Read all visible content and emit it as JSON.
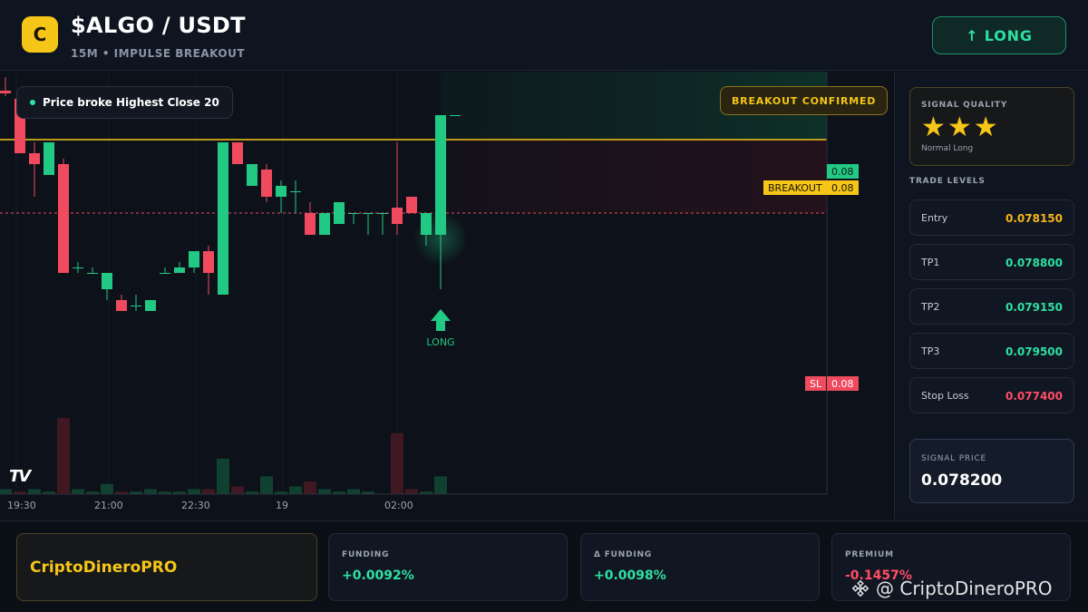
{
  "header": {
    "logo_letter": "C",
    "pair": "$ALGO / USDT",
    "subtitle": "15M • IMPULSE BREAKOUT",
    "direction_label": "↑ LONG"
  },
  "chart": {
    "tooltip": "Price broke Highest Close 20",
    "confirm_badge": "BREAKOUT CONFIRMED",
    "breakout_label": "BREAKOUT",
    "breakout_value": "0.08",
    "entry_value": "0.08",
    "sl_label": "SL",
    "sl_value": "0.08",
    "signal_marker": "LONG",
    "tv_logo": "TV",
    "time_labels": [
      "19:30",
      "21:00",
      "22:30",
      "19",
      "02:00"
    ]
  },
  "chart_data": {
    "type": "candlestick",
    "note_candles": "[open, high, low, close] approximate price units",
    "candles": [
      [
        0.07965,
        0.0799,
        0.07955,
        0.0796
      ],
      [
        0.0795,
        0.07955,
        0.0785,
        0.0785
      ],
      [
        0.0785,
        0.0787,
        0.0777,
        0.0783
      ],
      [
        0.0781,
        0.0782,
        0.0787,
        0.0787
      ],
      [
        0.0783,
        0.0784,
        0.0763,
        0.0763
      ],
      [
        0.0764,
        0.0765,
        0.0763,
        0.0764
      ],
      [
        0.0763,
        0.0764,
        0.0763,
        0.0763
      ],
      [
        0.076,
        0.0763,
        0.0758,
        0.0763
      ],
      [
        0.0758,
        0.0759,
        0.0756,
        0.0756
      ],
      [
        0.0757,
        0.0759,
        0.0756,
        0.0757
      ],
      [
        0.0756,
        0.0758,
        0.0756,
        0.0758
      ],
      [
        0.0763,
        0.0764,
        0.0763,
        0.0763
      ],
      [
        0.0763,
        0.0765,
        0.0763,
        0.0764
      ],
      [
        0.0764,
        0.0767,
        0.0763,
        0.0767
      ],
      [
        0.0767,
        0.0768,
        0.0759,
        0.0763
      ],
      [
        0.0759,
        0.0787,
        0.0759,
        0.0787
      ],
      [
        0.0787,
        0.0787,
        0.0783,
        0.0783
      ],
      [
        0.0779,
        0.0783,
        0.0779,
        0.0783
      ],
      [
        0.0782,
        0.0783,
        0.0776,
        0.0777
      ],
      [
        0.0777,
        0.078,
        0.0774,
        0.0779
      ],
      [
        0.0778,
        0.078,
        0.0774,
        0.0778
      ],
      [
        0.0774,
        0.0776,
        0.077,
        0.077
      ],
      [
        0.077,
        0.0774,
        0.077,
        0.0774
      ],
      [
        0.0772,
        0.0776,
        0.0772,
        0.0776
      ],
      [
        0.0774,
        0.0774,
        0.0772,
        0.0774
      ],
      [
        0.0774,
        0.0774,
        0.077,
        0.0774
      ],
      [
        0.0774,
        0.0774,
        0.077,
        0.0774
      ],
      [
        0.0775,
        0.0787,
        0.077,
        0.0772
      ],
      [
        0.0777,
        0.0777,
        0.0774,
        0.0774
      ],
      [
        0.077,
        0.0772,
        0.0768,
        0.0774
      ],
      [
        0.077,
        0.0792,
        0.076,
        0.0792
      ],
      [
        0.0792,
        0.0792,
        0.0792,
        0.0792
      ]
    ],
    "volumes": [
      2,
      1,
      2,
      1,
      30,
      2,
      1,
      4,
      1,
      1,
      2,
      1,
      1,
      2,
      2,
      14,
      3,
      1,
      7,
      1,
      3,
      5,
      2,
      1,
      2,
      1,
      0,
      24,
      2,
      1,
      7,
      0
    ],
    "volume_up": [
      true,
      false,
      true,
      true,
      false,
      true,
      true,
      true,
      false,
      true,
      true,
      true,
      true,
      true,
      false,
      true,
      false,
      true,
      true,
      true,
      true,
      false,
      true,
      true,
      true,
      true,
      true,
      false,
      false,
      true,
      true,
      true
    ],
    "levels": {
      "breakout": 0.07875,
      "stop_loss": 0.0774,
      "entry_box_top": 0.0796,
      "price_min": 0.074,
      "price_max": 0.08
    },
    "colors": {
      "up": "#22c985",
      "down": "#f04a5e",
      "breakout": "#f5c518",
      "sl": "#f04a5e"
    }
  },
  "sidebar": {
    "quality_label": "SIGNAL QUALITY",
    "stars": "★★★",
    "quality_note": "Normal Long",
    "levels_title": "TRADE LEVELS",
    "levels": [
      {
        "name": "Entry",
        "value": "0.078150",
        "color": "#f5b51a"
      },
      {
        "name": "TP1",
        "value": "0.078800",
        "color": "#2ee0a2"
      },
      {
        "name": "TP2",
        "value": "0.079150",
        "color": "#2ee0a2"
      },
      {
        "name": "TP3",
        "value": "0.079500",
        "color": "#2ee0a2"
      },
      {
        "name": "Stop Loss",
        "value": "0.077400",
        "color": "#ff4d65"
      }
    ],
    "signal_price_label": "SIGNAL PRICE",
    "signal_price": "0.078200"
  },
  "footer": {
    "brand": "CriptoDineroPRO",
    "metrics": [
      {
        "label": "FUNDING",
        "value": "+0.0092%",
        "color": "#2ee0a2"
      },
      {
        "label": "Δ FUNDING",
        "value": "+0.0098%",
        "color": "#2ee0a2"
      },
      {
        "label": "PREMIUM",
        "value": "-0.1457%",
        "color": "#ff4d65"
      }
    ],
    "watermark": "@ CriptoDineroPRO"
  }
}
